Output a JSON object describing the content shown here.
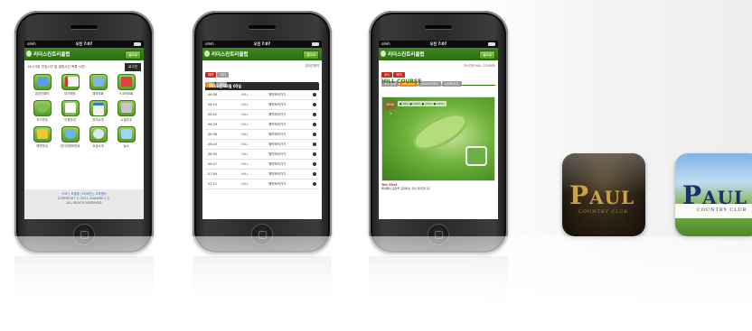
{
  "status": {
    "carrier": "olleh",
    "time": "오전 7:07"
  },
  "app": {
    "title": "리더스컨트리클럽",
    "home_button": "홈으로"
  },
  "phone1": {
    "welcome": "14시 9분 진입시간 및 발표시간 목록 시간!",
    "login": "로그인",
    "menu": [
      {
        "label": "온라인예약",
        "icon": "calendar-icon"
      },
      {
        "label": "대기예약",
        "icon": "clipboard-icon"
      },
      {
        "label": "예약조회",
        "icon": "monitor-icon"
      },
      {
        "label": "스코어조회",
        "icon": "scorecard-icon"
      },
      {
        "label": "코스안내",
        "icon": "course-icon"
      },
      {
        "label": "이용안내",
        "icon": "info-icon"
      },
      {
        "label": "공지소개",
        "icon": "notice-icon"
      },
      {
        "label": "시설안내",
        "icon": "facility-icon"
      },
      {
        "label": "예약안내",
        "icon": "pencil-icon"
      },
      {
        "label": "컨디션정보안내",
        "icon": "weather-icon"
      },
      {
        "label": "요금소개",
        "icon": "money-icon"
      },
      {
        "label": "날씨",
        "icon": "sky-icon"
      }
    ],
    "footer_links": "TOP | 도움말 | PC버전 | 고객센터",
    "copyright": "COPYRIGHT © 2011 LEADERS C.C.",
    "rights": "ALL RIGHTS RESERVED"
  },
  "phone2": {
    "tabs": [
      "예약",
      "대기"
    ],
    "breadcrumb": "온라인예약",
    "subtabs": [
      "1부",
      "2부"
    ],
    "date": "2011년 03월 05일",
    "rows": [
      {
        "time": "06:08",
        "course": "HILL",
        "status": "예약하러가기"
      },
      {
        "time": "06:15",
        "course": "HILL",
        "status": "예약하러가기"
      },
      {
        "time": "06:22",
        "course": "HILL",
        "status": "예약하러가기"
      },
      {
        "time": "06:29",
        "course": "HILL",
        "status": "예약하러가기"
      },
      {
        "time": "06:36",
        "course": "HILL",
        "status": "예약하러가기"
      },
      {
        "time": "06:43",
        "course": "HILL",
        "status": "예약하러가기"
      },
      {
        "time": "06:50",
        "course": "HILL",
        "status": "예약하러가기"
      },
      {
        "time": "06:57",
        "course": "HILL",
        "status": "예약하러가기"
      },
      {
        "time": "07:04",
        "course": "HILL",
        "status": "예약하러가기"
      },
      {
        "time": "07:11",
        "course": "HILL",
        "status": "예약하러가기"
      }
    ]
  },
  "phone3": {
    "tabs": [
      "코스",
      "예약"
    ],
    "breadcrumb": "코스안내 HILL COURSE",
    "course_tabs": [
      "코스전체",
      "HILL코스",
      "VALLEY코스",
      "LAKE코스"
    ],
    "course_title": "HILL COURSE",
    "holes": [
      "1",
      "2",
      "3",
      "4",
      "5",
      "6",
      "7",
      "8",
      "9"
    ],
    "hole_badge": "HOLE 1",
    "legend": "● 50m ● 100m ● 150m ● 200m",
    "tee_shot": "Tee Shot",
    "tee_text": "페어웨이 중앙을 공략하는 것이 유리합니다."
  },
  "icons": {
    "dark": {
      "brand_initial": "P",
      "brand_rest": "AUL",
      "sub": "COUNTRY CLUB"
    },
    "light": {
      "brand_initial": "P",
      "brand_rest": "AUL",
      "sub": "COUNTRY CLUB"
    }
  }
}
